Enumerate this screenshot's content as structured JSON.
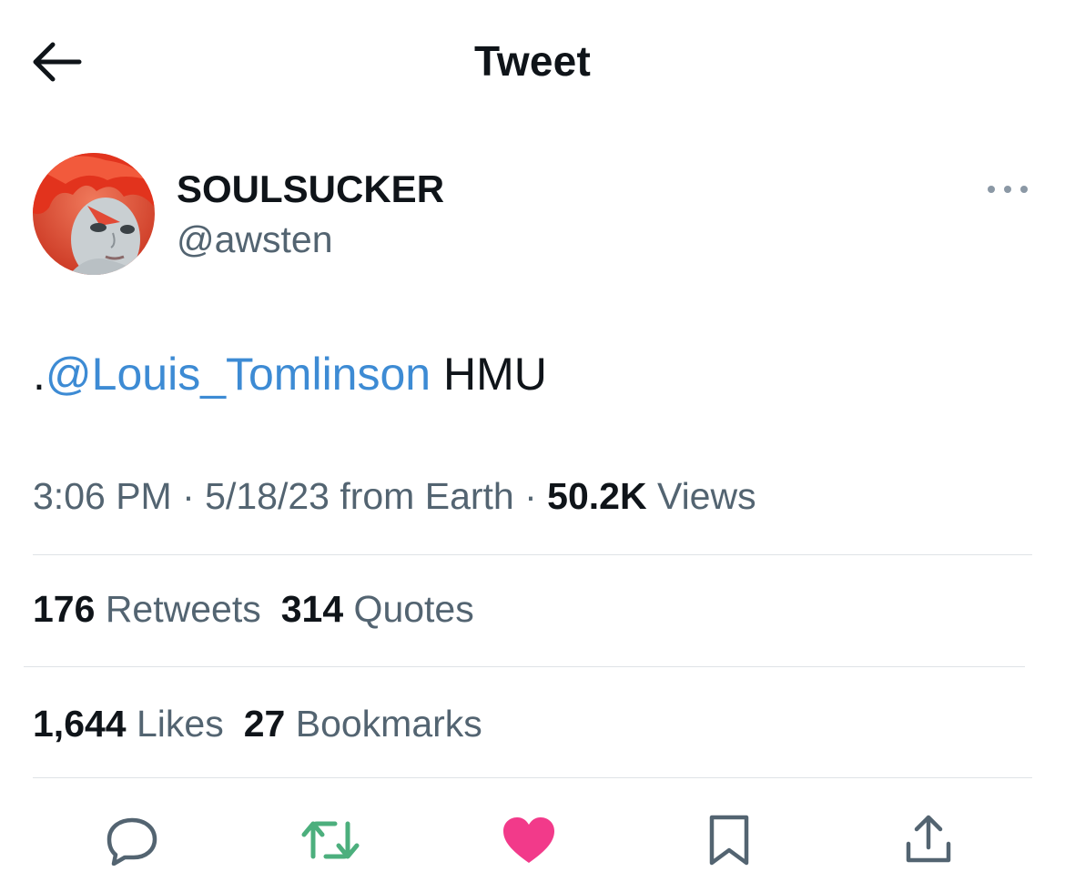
{
  "header": {
    "title": "Tweet",
    "back_icon": "arrow-left-icon"
  },
  "author": {
    "display_name": "SOULSUCKER",
    "handle": "@awsten",
    "more_icon": "more-horizontal-icon"
  },
  "tweet": {
    "prefix": ".",
    "mention": "@Louis_Tomlinson",
    "suffix": " HMU"
  },
  "meta": {
    "time": "3:06 PM",
    "sep1": " · ",
    "date": "5/18/23",
    "source": " from Earth",
    "sep2": " · ",
    "views_count": "50.2K",
    "views_label": " Views"
  },
  "stats": {
    "retweets_count": "176",
    "retweets_label": " Retweets",
    "quotes_count": "314",
    "quotes_label": " Quotes",
    "likes_count": "1,644",
    "likes_label": " Likes",
    "bookmarks_count": "27",
    "bookmarks_label": " Bookmarks"
  },
  "actions": {
    "reply_icon": "reply-icon",
    "retweet_icon": "retweet-icon",
    "like_icon": "heart-icon",
    "bookmark_icon": "bookmark-icon",
    "share_icon": "share-icon"
  },
  "colors": {
    "text": "#0f1419",
    "secondary": "#536471",
    "mention": "#3d8bd4",
    "retweet_green": "#4caf7d",
    "like_pink": "#f23a8a",
    "divider": "#dfe3e6"
  }
}
